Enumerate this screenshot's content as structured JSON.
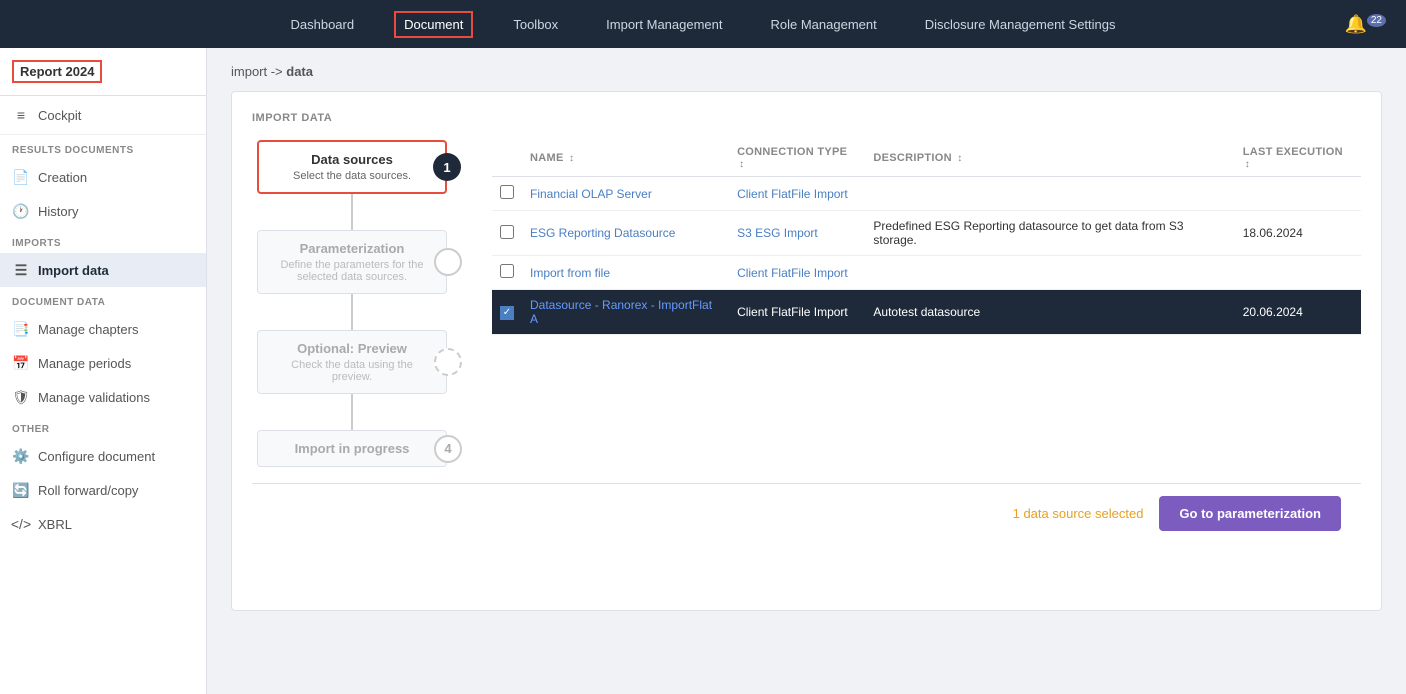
{
  "topNav": {
    "items": [
      {
        "label": "Dashboard",
        "active": false
      },
      {
        "label": "Document",
        "active": true
      },
      {
        "label": "Toolbox",
        "active": false
      },
      {
        "label": "Import Management",
        "active": false
      },
      {
        "label": "Role Management",
        "active": false
      },
      {
        "label": "Disclosure Management Settings",
        "active": false
      }
    ],
    "bell_count": "22"
  },
  "sidebar": {
    "report_label": "Report 2024",
    "cockpit_label": "Cockpit",
    "sections": [
      {
        "label": "RESULTS DOCUMENTS",
        "items": [
          {
            "label": "Creation",
            "icon": "📄",
            "active": false
          },
          {
            "label": "History",
            "icon": "🕐",
            "active": false
          }
        ]
      },
      {
        "label": "IMPORTS",
        "items": [
          {
            "label": "Import data",
            "icon": "📋",
            "active": true
          }
        ]
      },
      {
        "label": "DOCUMENT DATA",
        "items": [
          {
            "label": "Manage chapters",
            "icon": "📑",
            "active": false
          },
          {
            "label": "Manage periods",
            "icon": "📅",
            "active": false
          },
          {
            "label": "Manage validations",
            "icon": "🛡",
            "active": false
          }
        ]
      },
      {
        "label": "OTHER",
        "items": [
          {
            "label": "Configure document",
            "icon": "⚙️",
            "active": false
          },
          {
            "label": "Roll forward/copy",
            "icon": "🔄",
            "active": false
          },
          {
            "label": "XBRL",
            "icon": "</>",
            "active": false
          }
        ]
      }
    ]
  },
  "breadcrumb": {
    "prefix": "import -> ",
    "current": "data"
  },
  "importSection": {
    "title": "IMPORT DATA",
    "steps": [
      {
        "id": 1,
        "title": "Data sources",
        "subtitle": "Select the data sources.",
        "active": true,
        "number": "1",
        "number_type": "filled"
      },
      {
        "id": 2,
        "title": "Parameterization",
        "subtitle": "Define the parameters for the selected data sources.",
        "active": false,
        "number": "",
        "number_type": "outline"
      },
      {
        "id": 3,
        "title": "Optional: Preview",
        "subtitle": "Check the data using the preview.",
        "active": false,
        "number": "",
        "number_type": "dashed"
      },
      {
        "id": 4,
        "title": "Import in progress",
        "subtitle": "",
        "active": false,
        "number": "4",
        "number_type": "outline"
      }
    ],
    "table": {
      "columns": [
        {
          "label": "NAME",
          "key": "name"
        },
        {
          "label": "CONNECTION TYPE",
          "key": "connection_type"
        },
        {
          "label": "DESCRIPTION",
          "key": "description"
        },
        {
          "label": "LAST EXECUTION",
          "key": "last_execution"
        }
      ],
      "rows": [
        {
          "id": 1,
          "name": "Financial OLAP Server",
          "connection_type": "Client FlatFile Import",
          "description": "",
          "last_execution": "",
          "selected": false
        },
        {
          "id": 2,
          "name": "ESG Reporting Datasource",
          "connection_type": "S3 ESG Import",
          "description": "Predefined ESG Reporting datasource to get data from S3 storage.",
          "last_execution": "18.06.2024",
          "selected": false
        },
        {
          "id": 3,
          "name": "Import from file",
          "connection_type": "Client FlatFile Import",
          "description": "",
          "last_execution": "",
          "selected": false
        },
        {
          "id": 4,
          "name": "Datasource - Ranorex - ImportFlat A",
          "connection_type": "Client FlatFile Import",
          "description": "Autotest datasource",
          "last_execution": "20.06.2024",
          "selected": true
        }
      ]
    }
  },
  "footer": {
    "status_count": "1",
    "status_text": "data source selected",
    "button_label": "Go to parameterization"
  }
}
